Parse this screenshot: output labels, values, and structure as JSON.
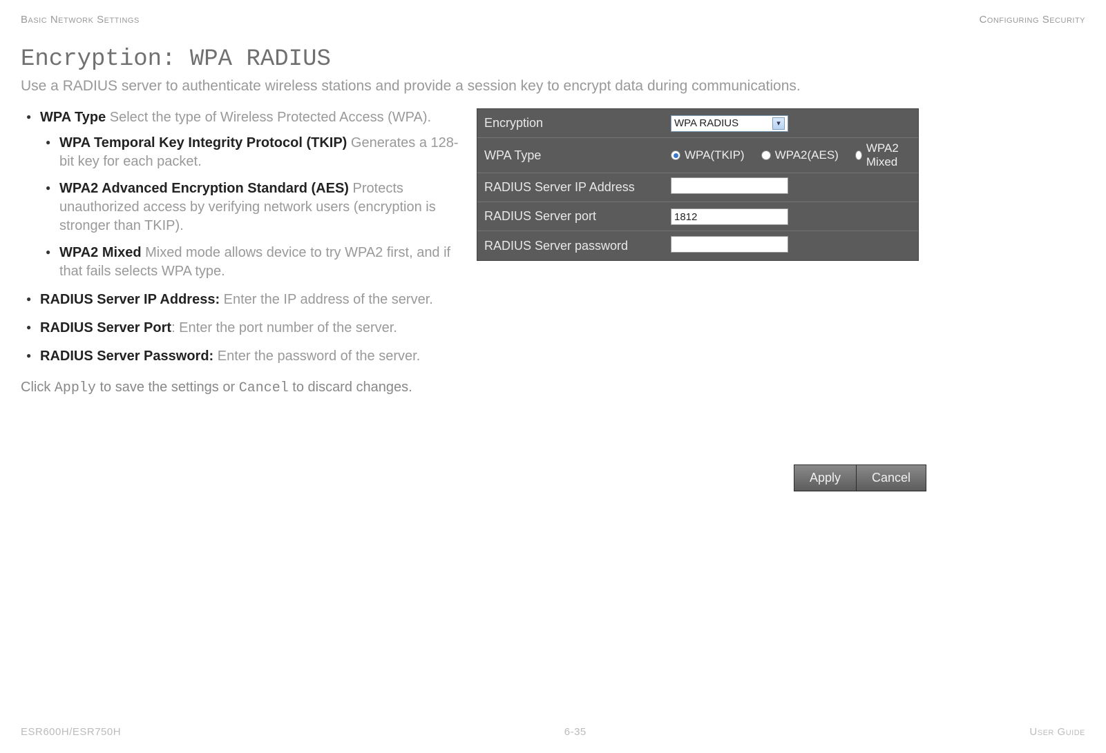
{
  "header": {
    "left": "Basic Network Settings",
    "right": "Configuring Security"
  },
  "title": "Encryption: WPA RADIUS",
  "subtitle": "Use a RADIUS server to authenticate wireless stations and provide a session key to encrypt data during communications.",
  "bullets": {
    "wpa_type": {
      "term": "WPA Type",
      "desc": "  Select the type of Wireless Protected Access (WPA)."
    },
    "tkip": {
      "term": "WPA Temporal Key Integrity Protocol (TKIP)",
      "desc": "  Generates a 128-bit key for each packet."
    },
    "aes": {
      "term": "WPA2 Advanced Encryption Standard (AES)",
      "desc": "  Protects unauthorized access by verifying network users (encryption is stronger than TKIP)."
    },
    "mixed": {
      "term": "WPA2 Mixed",
      "desc": "  Mixed mode allows device to try WPA2 first, and if that fails selects WPA type."
    },
    "ip": {
      "term": "RADIUS Server IP Address:",
      "desc": " Enter the IP address of the server."
    },
    "port": {
      "term": "RADIUS Server Port",
      "desc": ": Enter the port number of the server."
    },
    "password": {
      "term": "RADIUS Server Password:",
      "desc": " Enter the password of the server."
    }
  },
  "instructions": {
    "prefix": "Click ",
    "apply": "Apply",
    "middle": " to save the settings or ",
    "cancel": "Cancel",
    "suffix": " to discard changes."
  },
  "router": {
    "rows": {
      "encryption_label": "Encryption",
      "encryption_value": "WPA RADIUS",
      "wpa_type_label": "WPA Type",
      "wpa_type_options": {
        "tkip": "WPA(TKIP)",
        "aes": "WPA2(AES)",
        "mixed": "WPA2 Mixed"
      },
      "wpa_type_selected": "tkip",
      "ip_label": "RADIUS Server IP Address",
      "ip_value": "",
      "port_label": "RADIUS Server port",
      "port_value": "1812",
      "password_label": "RADIUS Server password",
      "password_value": ""
    },
    "buttons": {
      "apply": "Apply",
      "cancel": "Cancel"
    }
  },
  "footer": {
    "left": "ESR600H/ESR750H",
    "center": "6-35",
    "right": "User Guide"
  }
}
